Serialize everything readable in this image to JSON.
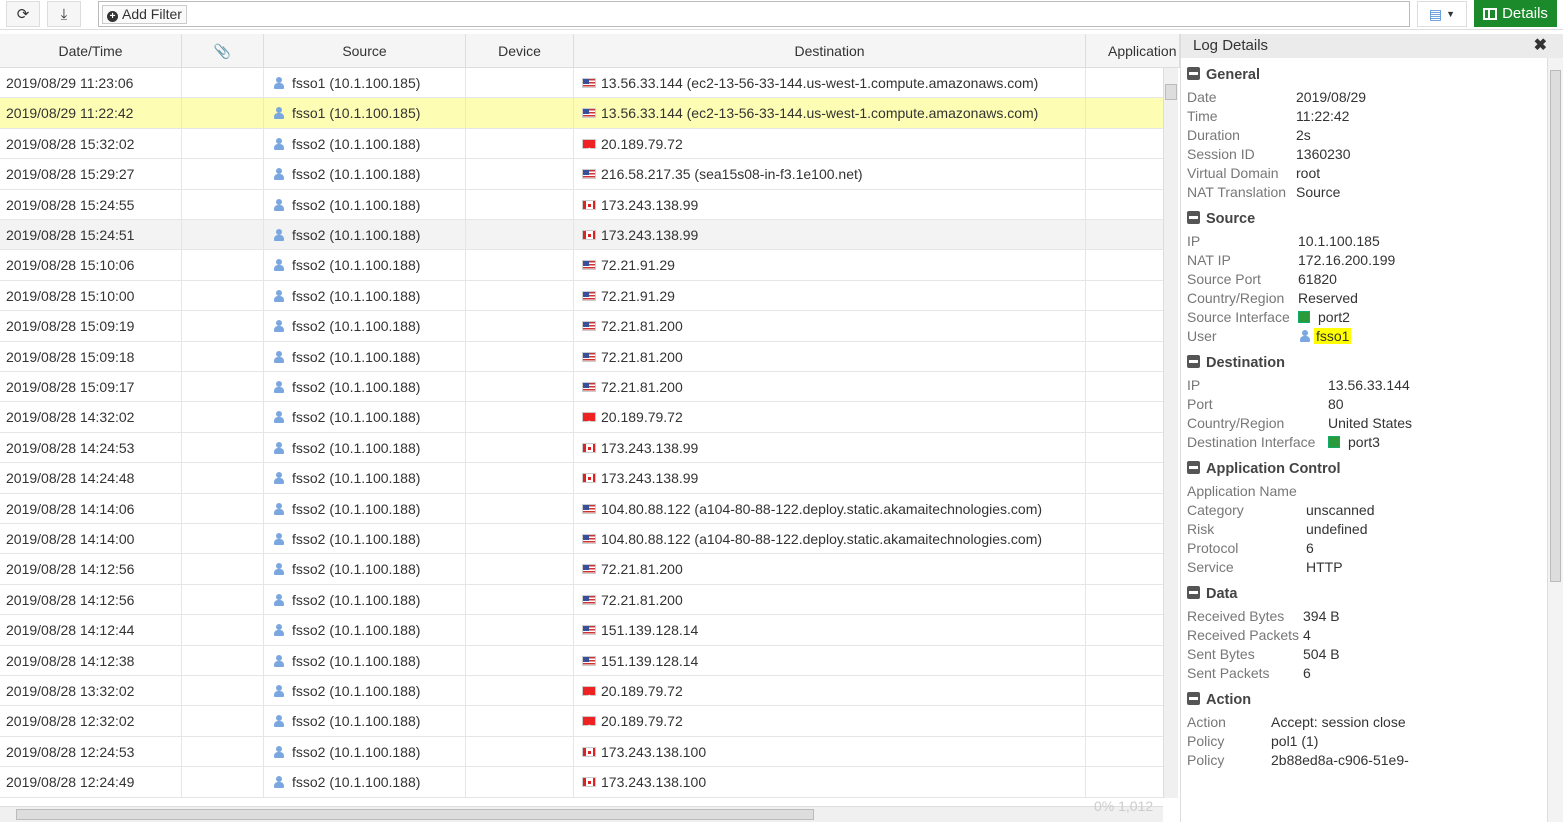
{
  "toolbar": {
    "add_filter": "Add Filter",
    "details": "Details"
  },
  "columns": [
    "Date/Time",
    "",
    "Source",
    "Device",
    "Destination",
    "Application"
  ],
  "rows": [
    {
      "time": "2019/08/29 11:23:06",
      "source": "fsso1 (10.1.100.185)",
      "flag": "us",
      "dest": "13.56.33.144 (ec2-13-56-33-144.us-west-1.compute.amazonaws.com)"
    },
    {
      "time": "2019/08/29 11:22:42",
      "source": "fsso1 (10.1.100.185)",
      "flag": "us",
      "dest": "13.56.33.144 (ec2-13-56-33-144.us-west-1.compute.amazonaws.com)",
      "selected": true
    },
    {
      "time": "2019/08/28 15:32:02",
      "source": "fsso2 (10.1.100.188)",
      "flag": "red",
      "dest": "20.189.79.72"
    },
    {
      "time": "2019/08/28 15:29:27",
      "source": "fsso2 (10.1.100.188)",
      "flag": "us",
      "dest": "216.58.217.35 (sea15s08-in-f3.1e100.net)"
    },
    {
      "time": "2019/08/28 15:24:55",
      "source": "fsso2 (10.1.100.188)",
      "flag": "ca",
      "dest": "173.243.138.99"
    },
    {
      "time": "2019/08/28 15:24:51",
      "source": "fsso2 (10.1.100.188)",
      "flag": "ca",
      "dest": "173.243.138.99",
      "hover": true
    },
    {
      "time": "2019/08/28 15:10:06",
      "source": "fsso2 (10.1.100.188)",
      "flag": "us",
      "dest": "72.21.91.29"
    },
    {
      "time": "2019/08/28 15:10:00",
      "source": "fsso2 (10.1.100.188)",
      "flag": "us",
      "dest": "72.21.91.29"
    },
    {
      "time": "2019/08/28 15:09:19",
      "source": "fsso2 (10.1.100.188)",
      "flag": "us",
      "dest": "72.21.81.200"
    },
    {
      "time": "2019/08/28 15:09:18",
      "source": "fsso2 (10.1.100.188)",
      "flag": "us",
      "dest": "72.21.81.200"
    },
    {
      "time": "2019/08/28 15:09:17",
      "source": "fsso2 (10.1.100.188)",
      "flag": "us",
      "dest": "72.21.81.200"
    },
    {
      "time": "2019/08/28 14:32:02",
      "source": "fsso2 (10.1.100.188)",
      "flag": "red",
      "dest": "20.189.79.72"
    },
    {
      "time": "2019/08/28 14:24:53",
      "source": "fsso2 (10.1.100.188)",
      "flag": "ca",
      "dest": "173.243.138.99"
    },
    {
      "time": "2019/08/28 14:24:48",
      "source": "fsso2 (10.1.100.188)",
      "flag": "ca",
      "dest": "173.243.138.99"
    },
    {
      "time": "2019/08/28 14:14:06",
      "source": "fsso2 (10.1.100.188)",
      "flag": "us",
      "dest": "104.80.88.122 (a104-80-88-122.deploy.static.akamaitechnologies.com)"
    },
    {
      "time": "2019/08/28 14:14:00",
      "source": "fsso2 (10.1.100.188)",
      "flag": "us",
      "dest": "104.80.88.122 (a104-80-88-122.deploy.static.akamaitechnologies.com)"
    },
    {
      "time": "2019/08/28 14:12:56",
      "source": "fsso2 (10.1.100.188)",
      "flag": "us",
      "dest": "72.21.81.200"
    },
    {
      "time": "2019/08/28 14:12:56",
      "source": "fsso2 (10.1.100.188)",
      "flag": "us",
      "dest": "72.21.81.200"
    },
    {
      "time": "2019/08/28 14:12:44",
      "source": "fsso2 (10.1.100.188)",
      "flag": "us",
      "dest": "151.139.128.14"
    },
    {
      "time": "2019/08/28 14:12:38",
      "source": "fsso2 (10.1.100.188)",
      "flag": "us",
      "dest": "151.139.128.14"
    },
    {
      "time": "2019/08/28 13:32:02",
      "source": "fsso2 (10.1.100.188)",
      "flag": "red",
      "dest": "20.189.79.72"
    },
    {
      "time": "2019/08/28 12:32:02",
      "source": "fsso2 (10.1.100.188)",
      "flag": "red",
      "dest": "20.189.79.72"
    },
    {
      "time": "2019/08/28 12:24:53",
      "source": "fsso2 (10.1.100.188)",
      "flag": "ca",
      "dest": "173.243.138.100"
    },
    {
      "time": "2019/08/28 12:24:49",
      "source": "fsso2 (10.1.100.188)",
      "flag": "ca",
      "dest": "173.243.138.100"
    }
  ],
  "footer": {
    "progress": "0% 1,012"
  },
  "panel": {
    "title": "Log Details",
    "sections": [
      {
        "title": "General",
        "valcol": 109,
        "items": [
          [
            "Date",
            "2019/08/29"
          ],
          [
            "Time",
            "11:22:42"
          ],
          [
            "Duration",
            "2s"
          ],
          [
            "Session ID",
            "1360230"
          ],
          [
            "Virtual Domain",
            "root"
          ],
          [
            "NAT Translation",
            "Source"
          ]
        ]
      },
      {
        "title": "Source",
        "valcol": 111,
        "items": [
          [
            "IP",
            "10.1.100.185"
          ],
          [
            "NAT IP",
            "172.16.200.199"
          ],
          [
            "Source Port",
            "61820"
          ],
          [
            "Country/Region",
            "Reserved"
          ],
          [
            "Source Interface",
            "port2",
            "port"
          ],
          [
            "User",
            "fsso1",
            "user"
          ]
        ]
      },
      {
        "title": "Destination",
        "valcol": 141,
        "items": [
          [
            "IP",
            "13.56.33.144"
          ],
          [
            "Port",
            "80"
          ],
          [
            "Country/Region",
            "United States"
          ],
          [
            "Destination Interface",
            "port3",
            "port"
          ]
        ]
      },
      {
        "title": "Application Control",
        "valcol": 119,
        "items": [
          [
            "Application Name",
            ""
          ],
          [
            "Category",
            "unscanned"
          ],
          [
            "Risk",
            "undefined"
          ],
          [
            "Protocol",
            "6"
          ],
          [
            "Service",
            "HTTP"
          ]
        ]
      },
      {
        "title": "Data",
        "valcol": 116,
        "items": [
          [
            "Received Bytes",
            "394 B"
          ],
          [
            "Received Packets",
            "4"
          ],
          [
            "Sent Bytes",
            "504 B"
          ],
          [
            "Sent Packets",
            "6"
          ]
        ]
      },
      {
        "title": "Action",
        "valcol": 84,
        "items": [
          [
            "Action",
            "Accept: session close"
          ],
          [
            "Policy",
            "pol1 (1)"
          ],
          [
            "Policy",
            "2b88ed8a-c906-51e9-"
          ]
        ]
      }
    ]
  }
}
